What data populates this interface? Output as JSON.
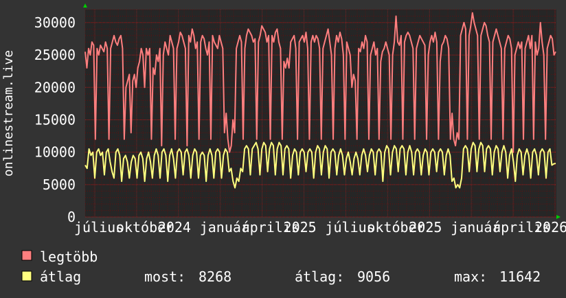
{
  "chart_data": {
    "type": "line",
    "ylabel": "onlinestream.live",
    "ylim": [
      0,
      32000
    ],
    "yticks": [
      "0",
      "5000",
      "10000",
      "15000",
      "20000",
      "25000",
      "30000"
    ],
    "xtick_labels": [
      "július",
      "október",
      "2024",
      "január",
      "április",
      "2025",
      "július",
      "október",
      "2025",
      "január",
      "április",
      "2026"
    ],
    "xtick_text_raw": "júliusoktóberjanuárápriliS júliusoktóberjanuárápriliS",
    "grid": true,
    "legend_position": "bottom-left",
    "series": [
      {
        "name": "legtöbb",
        "color": "#ff7f7f",
        "values": [
          25500,
          23000,
          26000,
          25000,
          27000,
          26500,
          12000,
          26000,
          25000,
          26500,
          26000,
          25500,
          27000,
          26000,
          12000,
          26000,
          27000,
          28000,
          27000,
          26500,
          27500,
          28000,
          26000,
          12000,
          20000,
          21000,
          22000,
          13000,
          21000,
          22000,
          20000,
          23000,
          24000,
          26000,
          25000,
          20000,
          26000,
          25000,
          26000,
          12000,
          23000,
          22000,
          25000,
          24000,
          26000,
          11000,
          25000,
          27000,
          26000,
          25000,
          28000,
          27000,
          26000,
          12000,
          26000,
          27000,
          28500,
          28000,
          27000,
          26000,
          11000,
          28000,
          27000,
          29000,
          28000,
          26000,
          27000,
          12000,
          27000,
          28000,
          27500,
          26000,
          25000,
          27000,
          12000,
          28000,
          27000,
          26500,
          26000,
          28000,
          27000,
          26000,
          13000,
          16000,
          12000,
          10000,
          11000,
          15000,
          13000,
          26000,
          27000,
          28000,
          27000,
          12000,
          26000,
          28000,
          29000,
          28500,
          28000,
          27000,
          27500,
          12000,
          27000,
          28000,
          29500,
          29000,
          28500,
          27000,
          28000,
          12000,
          28000,
          27000,
          28500,
          29000,
          27000,
          26000,
          12000,
          24000,
          23000,
          24500,
          23000,
          27000,
          27500,
          28000,
          26000,
          12000,
          27000,
          27500,
          28000,
          27000,
          28500,
          26000,
          12000,
          27000,
          28000,
          27000,
          28000,
          27500,
          26000,
          12000,
          26000,
          27000,
          28000,
          29000,
          27000,
          25000,
          12000,
          26000,
          28000,
          27000,
          28500,
          27500,
          25000,
          12000,
          27000,
          26000,
          25000,
          20000,
          22000,
          21000,
          12000,
          26000,
          25500,
          27000,
          26000,
          28000,
          27000,
          12000,
          25000,
          26000,
          27000,
          25000,
          26000,
          12000,
          24000,
          25500,
          26000,
          27000,
          26000,
          25000,
          12000,
          25000,
          27000,
          31000,
          27000,
          26500,
          28000,
          12000,
          27000,
          28000,
          28500,
          28000,
          27000,
          26000,
          12000,
          26000,
          27000,
          28000,
          27500,
          27000,
          26500,
          12000,
          25000,
          27000,
          28000,
          27000,
          28500,
          27000,
          12000,
          24000,
          26500,
          27000,
          28000,
          27500,
          26000,
          12000,
          16000,
          12000,
          11000,
          13000,
          12000,
          28000,
          29000,
          30000,
          29000,
          12000,
          28000,
          29500,
          31500,
          30000,
          29000,
          28000,
          12000,
          28000,
          29000,
          30000,
          29500,
          28000,
          27000,
          12000,
          27000,
          28000,
          29000,
          28000,
          27000,
          26000,
          12000,
          26000,
          27000,
          28000,
          27500,
          26000,
          10000,
          25000,
          26000,
          27000,
          26000,
          27000,
          12000,
          26000,
          27000,
          28000,
          26000,
          28000,
          12000,
          27000,
          25000,
          26000,
          30000,
          27000,
          25000,
          12000,
          26000,
          27000,
          28000,
          27500,
          25000,
          25500
        ]
      },
      {
        "name": "átlag",
        "color": "#ffff80",
        "values": [
          8000,
          7500,
          10500,
          9500,
          10000,
          6000,
          10000,
          10500,
          9500,
          10000,
          6500,
          10000,
          10500,
          8500,
          7000,
          6000,
          10000,
          10500,
          9500,
          5500,
          9000,
          9500,
          8500,
          6000,
          8500,
          9500,
          9000,
          6000,
          9500,
          10000,
          9000,
          5500,
          9000,
          10000,
          8500,
          6000,
          9500,
          10500,
          9500,
          6000,
          10000,
          10500,
          9500,
          5500,
          9500,
          10500,
          9000,
          6000,
          10000,
          10500,
          10000,
          6500,
          10000,
          10500,
          9500,
          6000,
          9500,
          10500,
          10000,
          6000,
          9500,
          10000,
          9500,
          5500,
          9500,
          10500,
          9500,
          6000,
          10000,
          10500,
          10000,
          6000,
          9500,
          10500,
          10000,
          7000,
          7500,
          5500,
          4500,
          6000,
          5500,
          7500,
          7000,
          10500,
          11000,
          10500,
          6500,
          10500,
          11000,
          11500,
          10500,
          6500,
          10500,
          11500,
          11000,
          7000,
          10500,
          11500,
          11000,
          6500,
          10500,
          11500,
          11000,
          6500,
          10500,
          11000,
          10500,
          6000,
          9500,
          10500,
          10000,
          6500,
          10000,
          10500,
          10000,
          7000,
          10000,
          10500,
          10000,
          6000,
          10000,
          11000,
          10500,
          6500,
          10000,
          11000,
          10500,
          6000,
          10000,
          10500,
          10000,
          6500,
          9500,
          10500,
          9500,
          6500,
          9000,
          10000,
          8500,
          6500,
          9000,
          10000,
          9000,
          6500,
          9500,
          10500,
          9500,
          7000,
          9500,
          10500,
          10000,
          6500,
          10000,
          10500,
          10000,
          5500,
          10000,
          11000,
          10500,
          6500,
          10000,
          11000,
          10500,
          7000,
          10500,
          11000,
          10500,
          6500,
          10000,
          11000,
          10000,
          6500,
          10000,
          10500,
          10000,
          6500,
          9500,
          10500,
          10000,
          6500,
          10000,
          10500,
          10000,
          7000,
          10000,
          10500,
          10000,
          6500,
          9500,
          10500,
          9500,
          5500,
          6000,
          4500,
          5000,
          4500,
          6000,
          10500,
          11000,
          10500,
          7000,
          10500,
          11500,
          11000,
          7000,
          10500,
          11500,
          11000,
          7000,
          10500,
          11000,
          10500,
          6500,
          10000,
          11000,
          10500,
          7000,
          10000,
          11000,
          10000,
          6000,
          9500,
          10500,
          8500,
          5500,
          9500,
          10500,
          10000,
          6500,
          9500,
          10500,
          9500,
          6000,
          10000,
          10500,
          9500,
          6500,
          10000,
          10500,
          10000,
          6000,
          10000,
          10500,
          8000,
          8200,
          8268
        ]
      }
    ]
  },
  "legend": [
    {
      "label": "legtöbb",
      "color": "#ff7f7f"
    },
    {
      "label": "átlag",
      "color": "#ffff80"
    }
  ],
  "stats": {
    "now_label": "most:",
    "now_value": "8268",
    "avg_label": "átlag:",
    "avg_value": "9056",
    "max_label": "max:",
    "max_value": "11642"
  },
  "colors": {
    "background": "#333333",
    "plot_background": "#262626",
    "grid": "#8b0000",
    "text": "#ffffff",
    "axis_arrow": "#00cc00"
  }
}
